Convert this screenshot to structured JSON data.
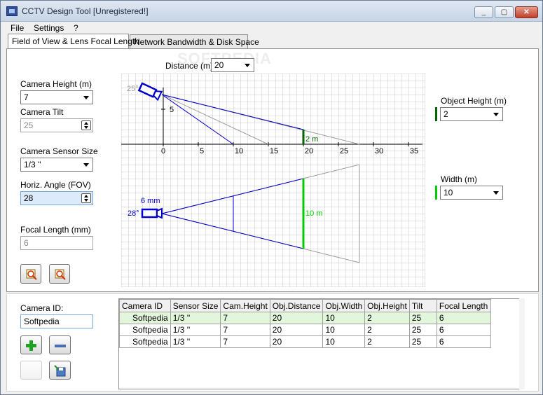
{
  "window": {
    "title": "CCTV Design Tool [Unregistered!]",
    "min_glyph": "_",
    "max_glyph": "▢",
    "close_glyph": "✕"
  },
  "menu": [
    "File",
    "Settings",
    "?"
  ],
  "tabs": [
    {
      "label": "Field of View & Lens Focal Length",
      "active": true
    },
    {
      "label": "Network Bandwidth & Disk Space",
      "active": false
    }
  ],
  "left_panel": {
    "camera_height": {
      "label": "Camera Height (m)",
      "value": "7"
    },
    "camera_tilt": {
      "label": "Camera Tilt",
      "value": "25"
    },
    "sensor_size": {
      "label": "Camera Sensor Size",
      "value": "1/3 ''"
    },
    "horiz_angle": {
      "label": "Horiz. Angle (FOV)",
      "value": "28"
    },
    "focal_length": {
      "label": "Focal Length (mm)",
      "value": "6"
    }
  },
  "distance": {
    "label": "Distance (m)",
    "value": "20"
  },
  "right_panel": {
    "object_height": {
      "label": "Object Height (m)",
      "value": "2"
    },
    "width": {
      "label": "Width (m)",
      "value": "10"
    }
  },
  "diagram": {
    "x_ticks": [
      "0",
      "5",
      "10",
      "15",
      "20",
      "25",
      "30",
      "35"
    ],
    "y_tick": "5",
    "side_angle_label": "25°",
    "side_object_label": "2 m",
    "top_angle_label": "28°",
    "top_focal_label": "6 mm",
    "top_object_label": "10 m"
  },
  "camera_id": {
    "label": "Camera ID:",
    "value": "Softpedia"
  },
  "table": {
    "columns": [
      "Camera ID",
      "Sensor Size",
      "Cam.Height",
      "Obj.Distance",
      "Obj.Width",
      "Obj.Height",
      "Tilt",
      "Focal Length"
    ],
    "rows": [
      [
        "Softpedia",
        "1/3 ''",
        "7",
        "20",
        "10",
        "2",
        "25",
        "6"
      ],
      [
        "Softpedia",
        "1/3 ''",
        "7",
        "20",
        "10",
        "2",
        "25",
        "6"
      ],
      [
        "Softpedia",
        "1/3 ''",
        "7",
        "20",
        "10",
        "2",
        "25",
        "6"
      ]
    ]
  },
  "colors": {
    "line_blue": "#0000cc",
    "object_green": "#00cc00",
    "dark_green": "#006600",
    "grid": "#c8c8c8"
  }
}
